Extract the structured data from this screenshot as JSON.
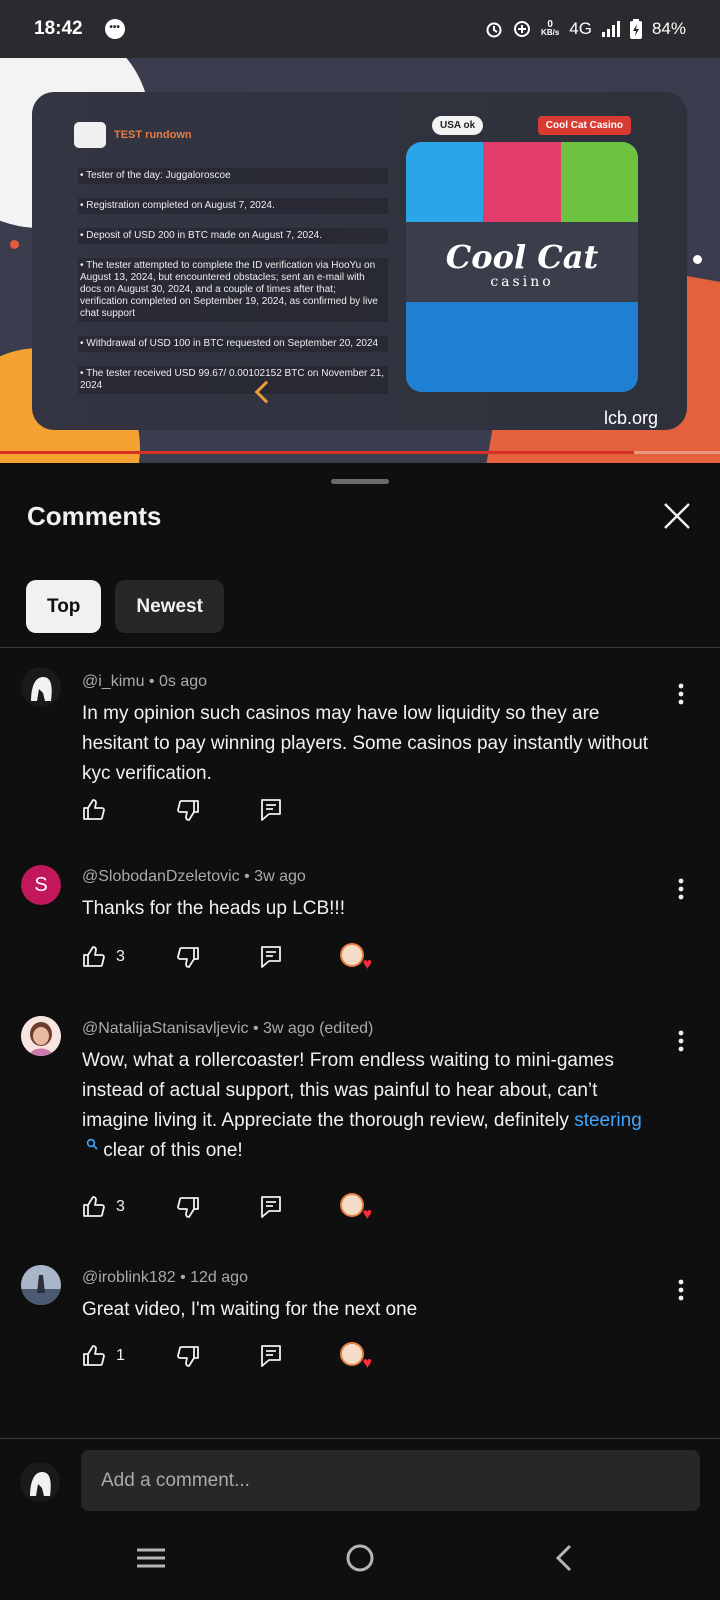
{
  "status_bar": {
    "time": "18:42",
    "network_speed_value": "0",
    "network_speed_unit": "KB/s",
    "network_type": "4G",
    "battery": "84%"
  },
  "video": {
    "card_title": "TEST rundown",
    "badge_usa": "USA ok",
    "badge_casino": "Cool Cat Casino",
    "lines": [
      "• Tester of the day: Juggaloroscoe",
      "• Registration completed on August 7, 2024.",
      "• Deposit of USD 200 in BTC made on August 7, 2024.",
      "• The tester attempted to complete the ID verification via HooYu on August 13, 2024, but encountered obstacles; sent an e-mail with docs on August 30, 2024, and a couple of times after that; verification completed on September 19, 2024, as confirmed by live chat support",
      "• Withdrawal of USD 100 in BTC requested on September 20, 2024",
      "• The tester received USD 99.67/ 0.00102152 BTC on November 21, 2024"
    ],
    "logo_title": "Cool Cat",
    "logo_sub": "casino",
    "watermark": "lcb.org",
    "progress_fraction": 0.88
  },
  "comments_panel": {
    "title": "Comments",
    "tabs": [
      {
        "label": "Top",
        "active": true
      },
      {
        "label": "Newest",
        "active": false
      }
    ],
    "comments": [
      {
        "author": "@i_kimu",
        "time": "0s ago",
        "text": "In my opinion such casinos may have low liquidity so they are hesitant to pay winning players. Some casinos pay instantly without kyc verification.",
        "likes": "",
        "creator_heart": false
      },
      {
        "author": "@SlobodanDzeletovic",
        "time": "3w ago",
        "avatar_letter": "S",
        "avatar_color": "#c2185b",
        "text": "Thanks for the heads up LCB!!!",
        "likes": "3",
        "creator_heart": true
      },
      {
        "author": "@NatalijaStanisavljevic",
        "time": "3w ago (edited)",
        "text_before": "Wow, what a rollercoaster! From endless waiting to mini-games instead of actual support, this was painful to hear about, can’t imagine living it. Appreciate the thorough review, definitely ",
        "text_link": "steering",
        "text_after": " clear of this one!",
        "likes": "3",
        "creator_heart": true
      },
      {
        "author": "@iroblink182",
        "time": "12d ago",
        "text": "Great video, I'm waiting for the next one",
        "likes": "1",
        "creator_heart": true
      }
    ],
    "add_comment_placeholder": "Add a comment..."
  },
  "colors": {
    "background": "#0f0f0f",
    "link": "#3ea6ff",
    "heart": "#ff2a3c",
    "chip_active": "#f1f1f1",
    "chip_inactive": "#272727"
  },
  "icons": {
    "close": "close-icon",
    "like": "thumb-up-icon",
    "dislike": "thumb-down-icon",
    "reply": "reply-icon",
    "more": "more-vert-icon",
    "search": "search-icon",
    "nav_recents": "recents-icon",
    "nav_home": "home-icon",
    "nav_back": "back-icon"
  }
}
